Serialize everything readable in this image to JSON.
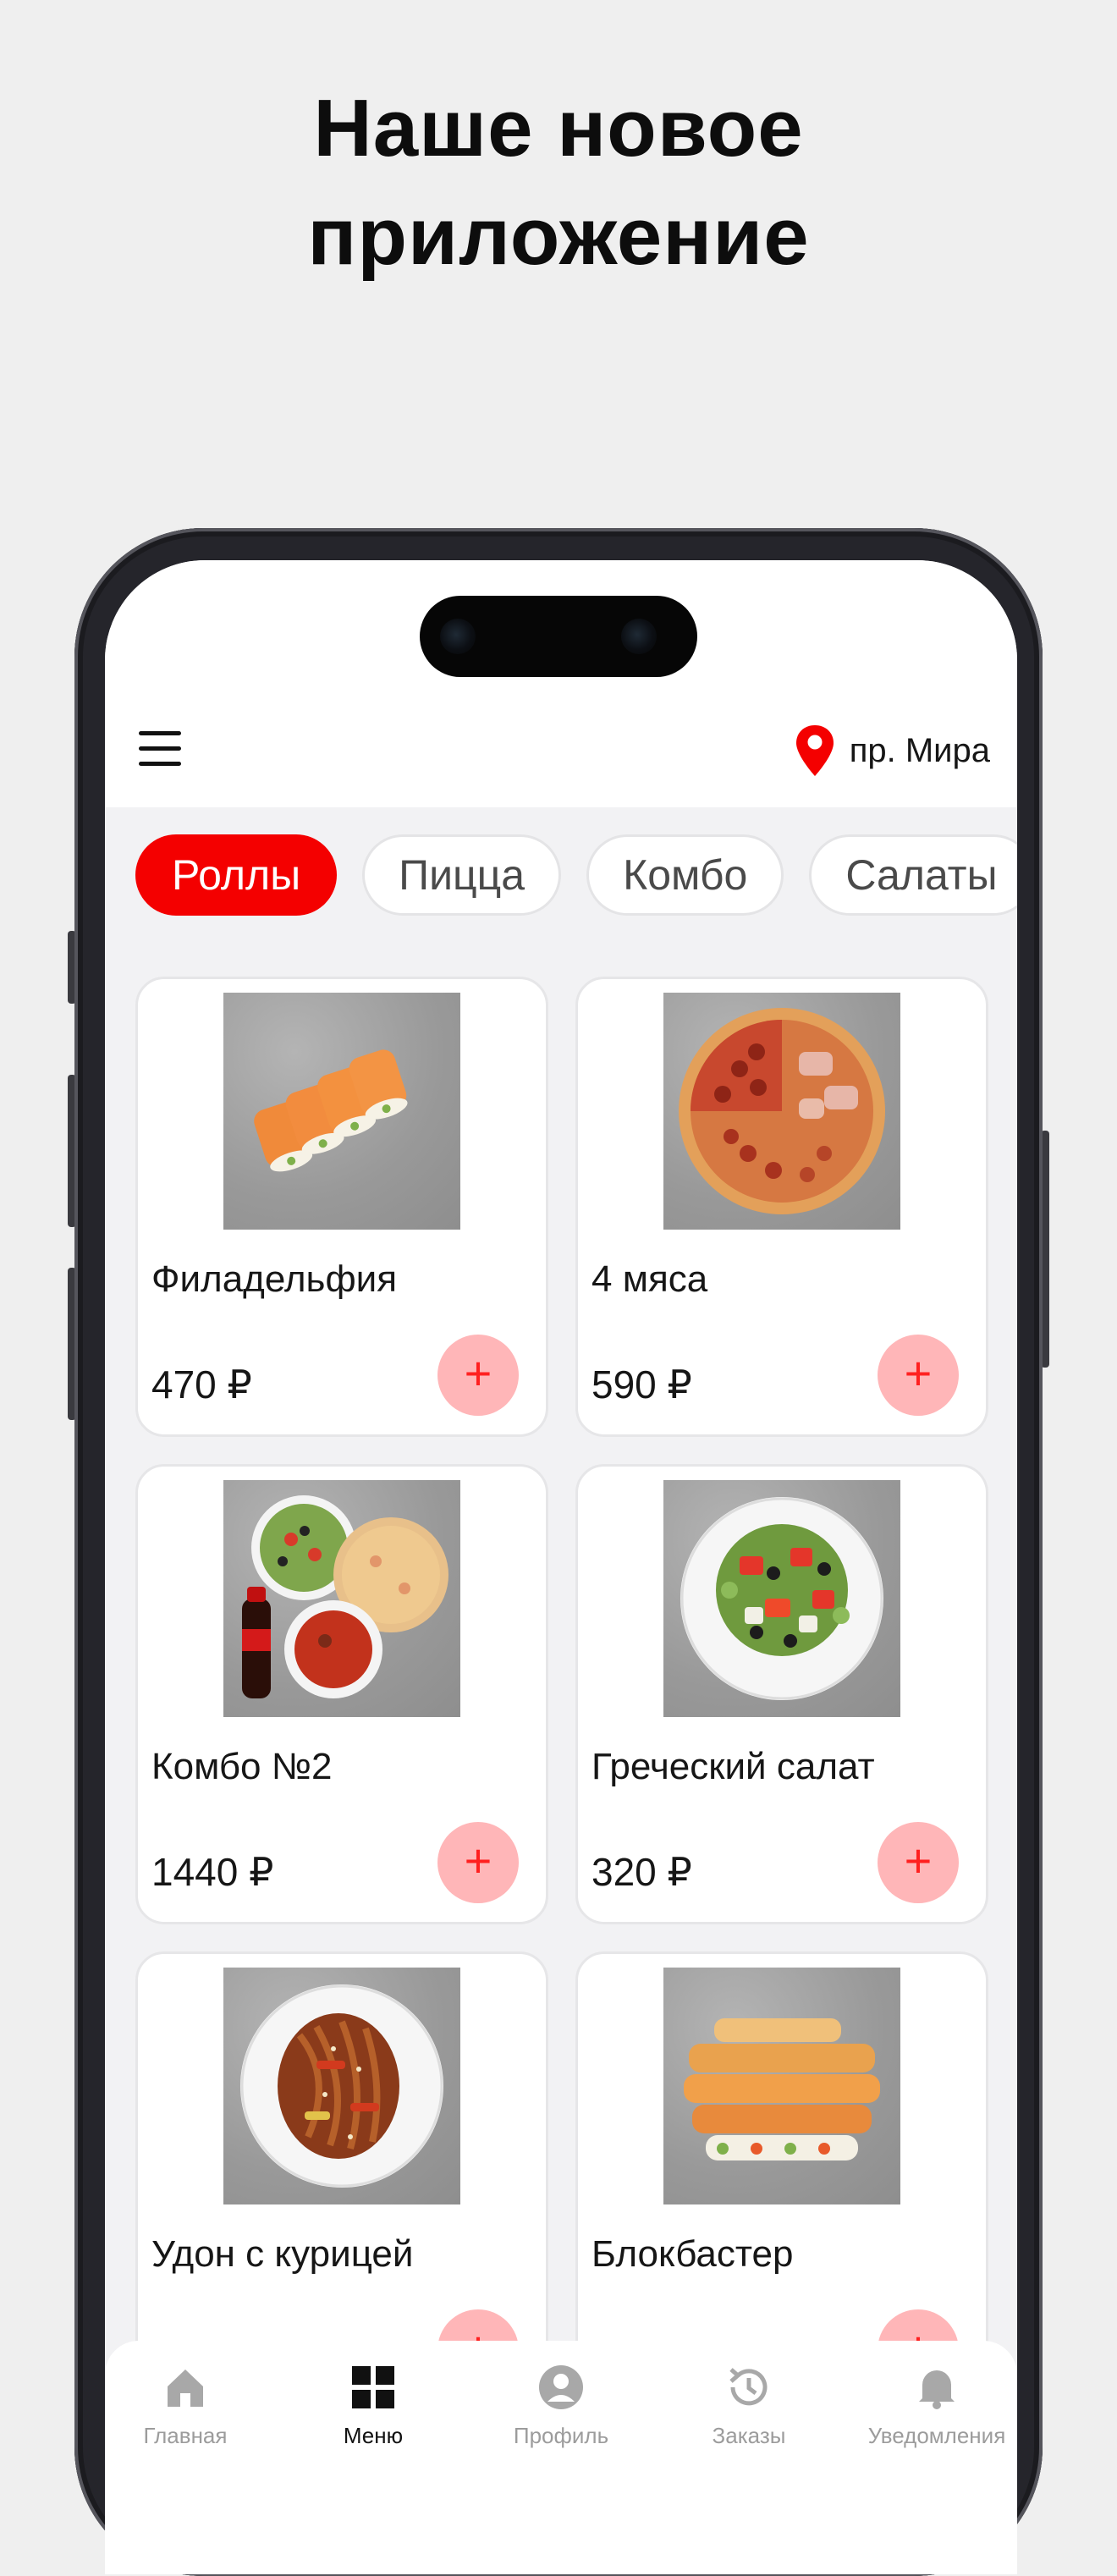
{
  "headline": {
    "line1": "Наше новое",
    "line2": "приложение"
  },
  "header": {
    "location": "пр. Мира"
  },
  "categories": [
    {
      "label": "Роллы",
      "active": true
    },
    {
      "label": "Пицца",
      "active": false
    },
    {
      "label": "Комбо",
      "active": false
    },
    {
      "label": "Салаты",
      "active": false
    }
  ],
  "products": [
    {
      "name": "Филадельфия",
      "price": "470 ₽",
      "add": "+"
    },
    {
      "name": "4 мяса",
      "price": "590 ₽",
      "add": "+"
    },
    {
      "name": "Комбо №2",
      "price": "1440 ₽",
      "add": "+"
    },
    {
      "name": "Греческий салат",
      "price": "320 ₽",
      "add": "+"
    },
    {
      "name": "Удон с курицей",
      "price": "",
      "add": "+"
    },
    {
      "name": "Блокбастер",
      "price": "",
      "add": "+"
    }
  ],
  "tabs": [
    {
      "label": "Главная",
      "icon": "home-icon"
    },
    {
      "label": "Меню",
      "icon": "grid-icon"
    },
    {
      "label": "Профиль",
      "icon": "profile-icon"
    },
    {
      "label": "Заказы",
      "icon": "history-icon"
    },
    {
      "label": "Уведомления",
      "icon": "bell-icon"
    }
  ],
  "colors": {
    "accent": "#f40000",
    "add_bg": "#ffb6b8",
    "add_fg": "#ff2020"
  }
}
